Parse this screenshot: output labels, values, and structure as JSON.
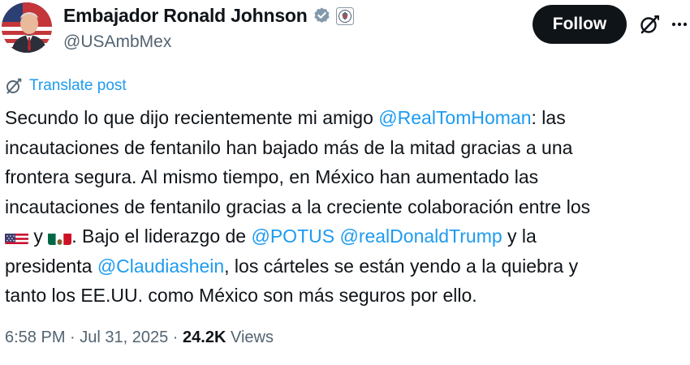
{
  "author": {
    "display_name": "Embajador Ronald Johnson",
    "handle": "@USAmbMex"
  },
  "actions": {
    "follow_label": "Follow"
  },
  "translate": {
    "label": "Translate post"
  },
  "post": {
    "line1": {
      "text_a": "Secundo lo que dijo recientemente mi amigo ",
      "mention": "@RealTomHoman",
      "text_b": ": las"
    },
    "line2": "incautaciones de fentanilo han bajado más de la mitad gracias a una",
    "line3": "frontera segura. Al mismo tiempo, en México han aumentado las",
    "line4": "incautaciones de fentanilo gracias a la creciente colaboración entre los",
    "line5": {
      "text_a": " y ",
      "text_b": ". Bajo el liderazgo de ",
      "mention_a": "@POTUS",
      "space": " ",
      "mention_b": "@realDonaldTrump",
      "text_c": " y la"
    },
    "line6": {
      "text_a": "presidenta ",
      "mention": "@Claudiashein",
      "text_b": ", los cárteles se están yendo a la quiebra y"
    },
    "line7": "tanto los EE.UU. como México son más seguros por ello."
  },
  "meta": {
    "time": "6:58 PM",
    "separator": " · ",
    "date": "Jul 31, 2025",
    "views_count": "24.2K",
    "views_label": " Views"
  },
  "colors": {
    "link": "#1d9bf0",
    "text": "#0f1419",
    "secondary": "#536471",
    "follow_bg": "#0f1419"
  },
  "icons": {
    "verified": "verified-badge-icon",
    "gov": "government-seal-icon",
    "grok": "grok-icon",
    "more": "more-options-icon",
    "translate": "translate-globe-icon",
    "flag_us": "us-flag-icon",
    "flag_mx": "mexico-flag-icon"
  }
}
